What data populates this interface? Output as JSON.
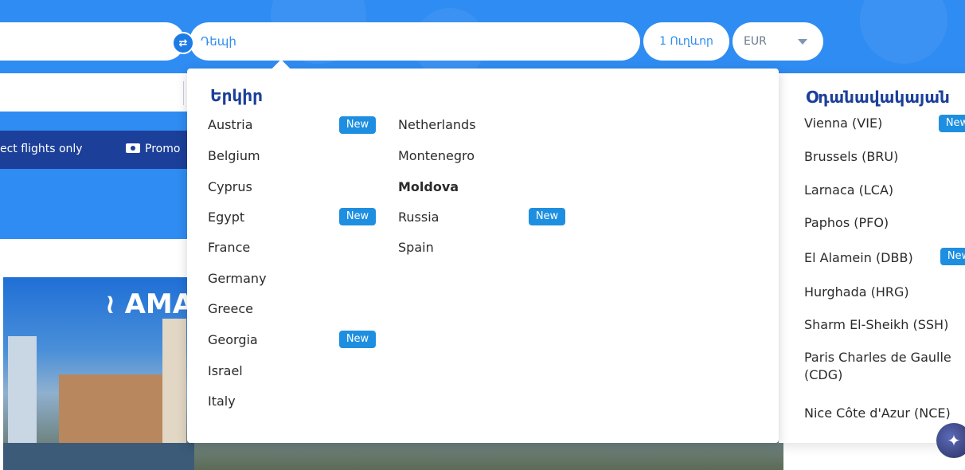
{
  "search": {
    "to_placeholder": "Դեպի",
    "to_value": "",
    "passengers": "1 Ուղևոր",
    "currency": "EUR"
  },
  "filters": {
    "direct_label": "ect flights only",
    "promo_label": "Promo"
  },
  "banner": {
    "text": "AMA"
  },
  "dropdown": {
    "countries_title": "Երկիր",
    "countries_left": [
      {
        "name": "Austria",
        "badge": "New"
      },
      {
        "name": "Belgium",
        "badge": ""
      },
      {
        "name": "Cyprus",
        "badge": ""
      },
      {
        "name": "Egypt",
        "badge": "New"
      },
      {
        "name": "France",
        "badge": ""
      },
      {
        "name": "Germany",
        "badge": ""
      },
      {
        "name": "Greece",
        "badge": ""
      },
      {
        "name": "Georgia",
        "badge": "New"
      },
      {
        "name": "Israel",
        "badge": ""
      },
      {
        "name": "Italy",
        "badge": ""
      }
    ],
    "countries_right": [
      {
        "name": "Netherlands",
        "badge": ""
      },
      {
        "name": "Montenegro",
        "badge": ""
      },
      {
        "name": "Moldova",
        "badge": "",
        "selected": true
      },
      {
        "name": "Russia",
        "badge": "New"
      },
      {
        "name": "Spain",
        "badge": ""
      }
    ]
  },
  "airports": {
    "title": "Օդանավակայան",
    "items": [
      {
        "name": "Vienna (VIE)",
        "badge": "New"
      },
      {
        "name": "Brussels (BRU)",
        "badge": ""
      },
      {
        "name": "Larnaca (LCA)",
        "badge": ""
      },
      {
        "name": "Paphos (PFO)",
        "badge": ""
      },
      {
        "name": "El Alamein (DBB)",
        "badge": "New"
      },
      {
        "name": "Hurghada (HRG)",
        "badge": ""
      },
      {
        "name": "Sharm El-Sheikh (SSH)",
        "badge": ""
      },
      {
        "name": "Paris Charles de Gaulle (CDG)",
        "badge": ""
      },
      {
        "name": "Nice Côte d'Azur (NCE)",
        "badge": ""
      }
    ]
  },
  "colors": {
    "brand_blue": "#2f8cf2",
    "navy": "#1c3f99",
    "badge": "#1e8fe0"
  }
}
